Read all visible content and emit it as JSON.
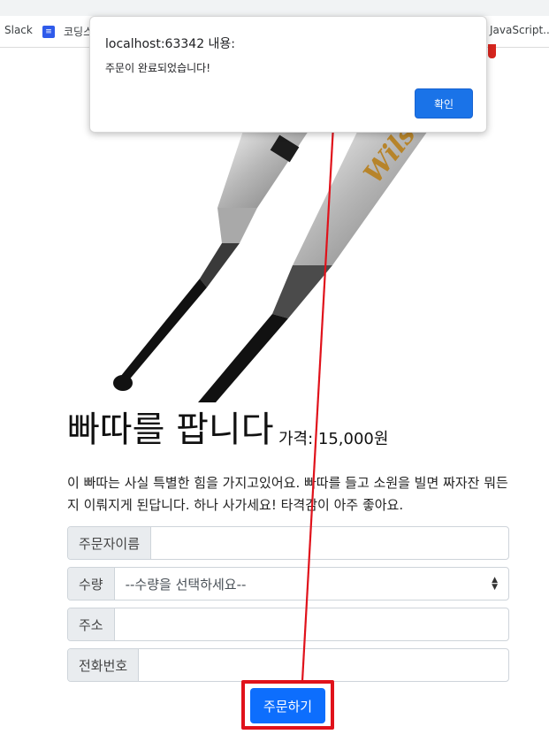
{
  "bookmarks": {
    "items": [
      {
        "label": "Slack",
        "icon": "slack-icon"
      },
      {
        "label": "코딩스",
        "icon": "coding-bookmark-icon"
      },
      {
        "label": "JavaScript..."
      }
    ]
  },
  "product": {
    "title": "빠따를 팝니다",
    "price": "가격: 15,000원",
    "description": "이 빠따는 사실 특별한 힘을 가지고있어요. 빠따를 들고 소원을 빌면 짜자잔 뭐든지 이뤄지게 된답니다. 하나 사가세요! 타격감이 아주 좋아요.",
    "brand_text": "Wilson",
    "image_icon": "baseball-bat-image"
  },
  "form": {
    "name_label": "주문자이름",
    "name_value": "",
    "quantity_label": "수량",
    "quantity_selected": "--수량을 선택하세요--",
    "address_label": "주소",
    "address_value": "",
    "phone_label": "전화번호",
    "phone_value": "",
    "order_button": "주문하기"
  },
  "alert": {
    "title": "localhost:63342 내용:",
    "message": "주문이 완료되었습니다!",
    "confirm_button": "확인"
  },
  "colors": {
    "primary": "#0d6efd",
    "dialog_button": "#1a73e8",
    "annotation": "#e0121b"
  }
}
